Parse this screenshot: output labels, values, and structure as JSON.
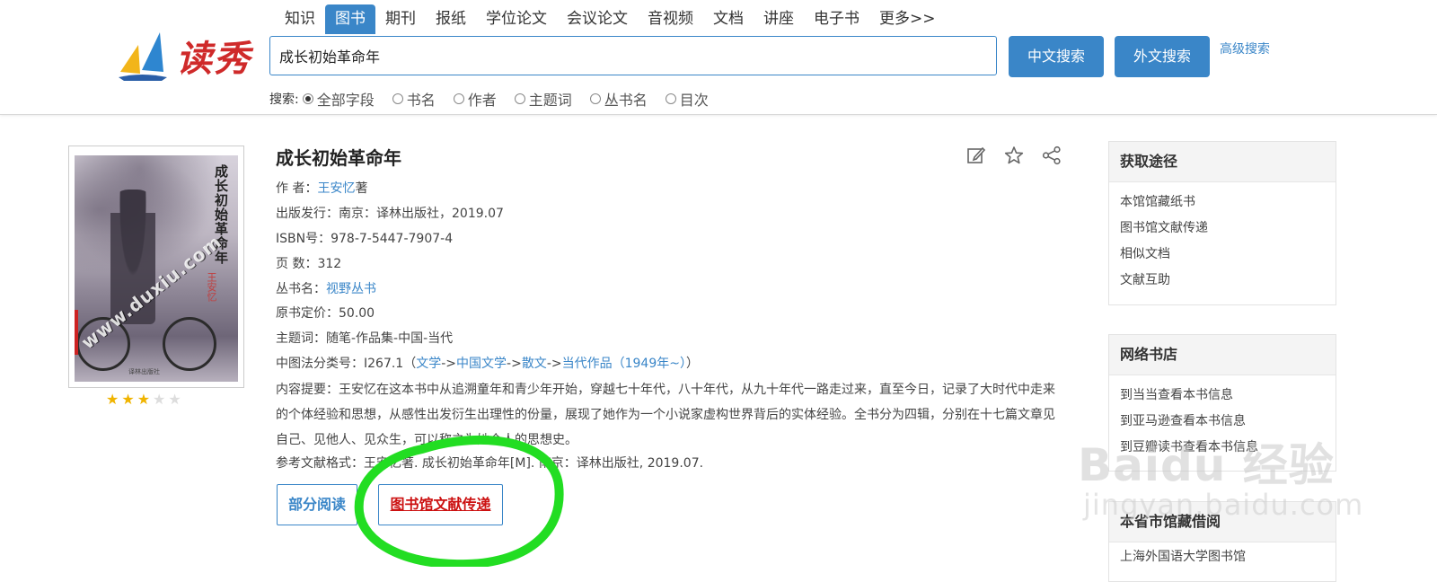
{
  "logo": {
    "text": "读秀"
  },
  "nav": {
    "tabs": [
      {
        "label": "知识",
        "active": false
      },
      {
        "label": "图书",
        "active": true
      },
      {
        "label": "期刊",
        "active": false
      },
      {
        "label": "报纸",
        "active": false
      },
      {
        "label": "学位论文",
        "active": false
      },
      {
        "label": "会议论文",
        "active": false
      },
      {
        "label": "音视频",
        "active": false
      },
      {
        "label": "文档",
        "active": false
      },
      {
        "label": "讲座",
        "active": false
      },
      {
        "label": "电子书",
        "active": false
      },
      {
        "label": "更多>>",
        "active": false
      }
    ]
  },
  "search": {
    "value": "成长初始革命年",
    "cn_button": "中文搜索",
    "foreign_button": "外文搜索",
    "advanced": "高级搜索",
    "scope_label": "搜索:",
    "scopes": [
      {
        "label": "全部字段",
        "checked": true
      },
      {
        "label": "书名",
        "checked": false
      },
      {
        "label": "作者",
        "checked": false
      },
      {
        "label": "主题词",
        "checked": false
      },
      {
        "label": "丛书名",
        "checked": false
      },
      {
        "label": "目次",
        "checked": false
      }
    ]
  },
  "cover": {
    "title": "成长初始革命年",
    "author": "王安忆",
    "watermark": "www.duxiu.com",
    "publisher_mark": "译林出版社"
  },
  "rating": {
    "value": 3,
    "max": 5
  },
  "book": {
    "title": "成长初始革命年",
    "author_label": "作 者：",
    "author": "王安忆",
    "author_suffix": "著",
    "publish_label": "出版发行：",
    "publish": "南京：译林出版社，2019.07",
    "isbn_label": "ISBN号：",
    "isbn": "978-7-5447-7907-4",
    "pages_label": "页 数：",
    "pages": "312",
    "series_label": "丛书名：",
    "series": "视野丛书",
    "price_label": "原书定价：",
    "price": "50.00",
    "subject_label": "主题词：",
    "subject": "随笔-作品集-中国-当代",
    "clc_label": "中图法分类号：",
    "clc": "I267.1",
    "clc_open": "（",
    "clc_path": [
      "文学",
      "中国文学",
      "散文",
      "当代作品（1949年~）"
    ],
    "clc_sep": "->",
    "clc_close": "）",
    "abstract_label": "内容提要：",
    "abstract": "王安忆在这本书中从追溯童年和青少年开始，穿越七十年代，八十年代，从九十年代一路走过来，直至今日，记录了大时代中走来的个体经验和思想，从感性出发衍生出理性的份量，展现了她作为一个小说家虚构世界背后的实体经验。全书分为四辑，分别在十七篇文章见自己、见他人、见众生，可以称之为她个人的思想史。",
    "citation_label": "参考文献格式：",
    "citation": "王安忆著. 成长初始革命年[M]. 南京：译林出版社, 2019.07."
  },
  "actions": {
    "partial_read": "部分阅读",
    "doc_delivery": "图书馆文献传递"
  },
  "panels": {
    "access": {
      "title": "获取途径",
      "items": [
        "本馆馆藏纸书",
        "图书馆文献传递",
        "相似文档",
        "文献互助"
      ]
    },
    "stores": {
      "title": "网络书店",
      "items": [
        "到当当查看本书信息",
        "到亚马逊查看本书信息",
        "到豆瓣读书查看本书信息"
      ]
    },
    "local": {
      "title": "本省市馆藏借阅",
      "items": [
        "上海外国语大学图书馆"
      ]
    }
  },
  "watermark": {
    "brand": "Baidu 经验",
    "url": "jingyan.baidu.com"
  },
  "colors": {
    "accent": "#3a86c8",
    "link_red": "#cc1111",
    "annotation_green": "#22dd22",
    "star": "#f0b400"
  }
}
